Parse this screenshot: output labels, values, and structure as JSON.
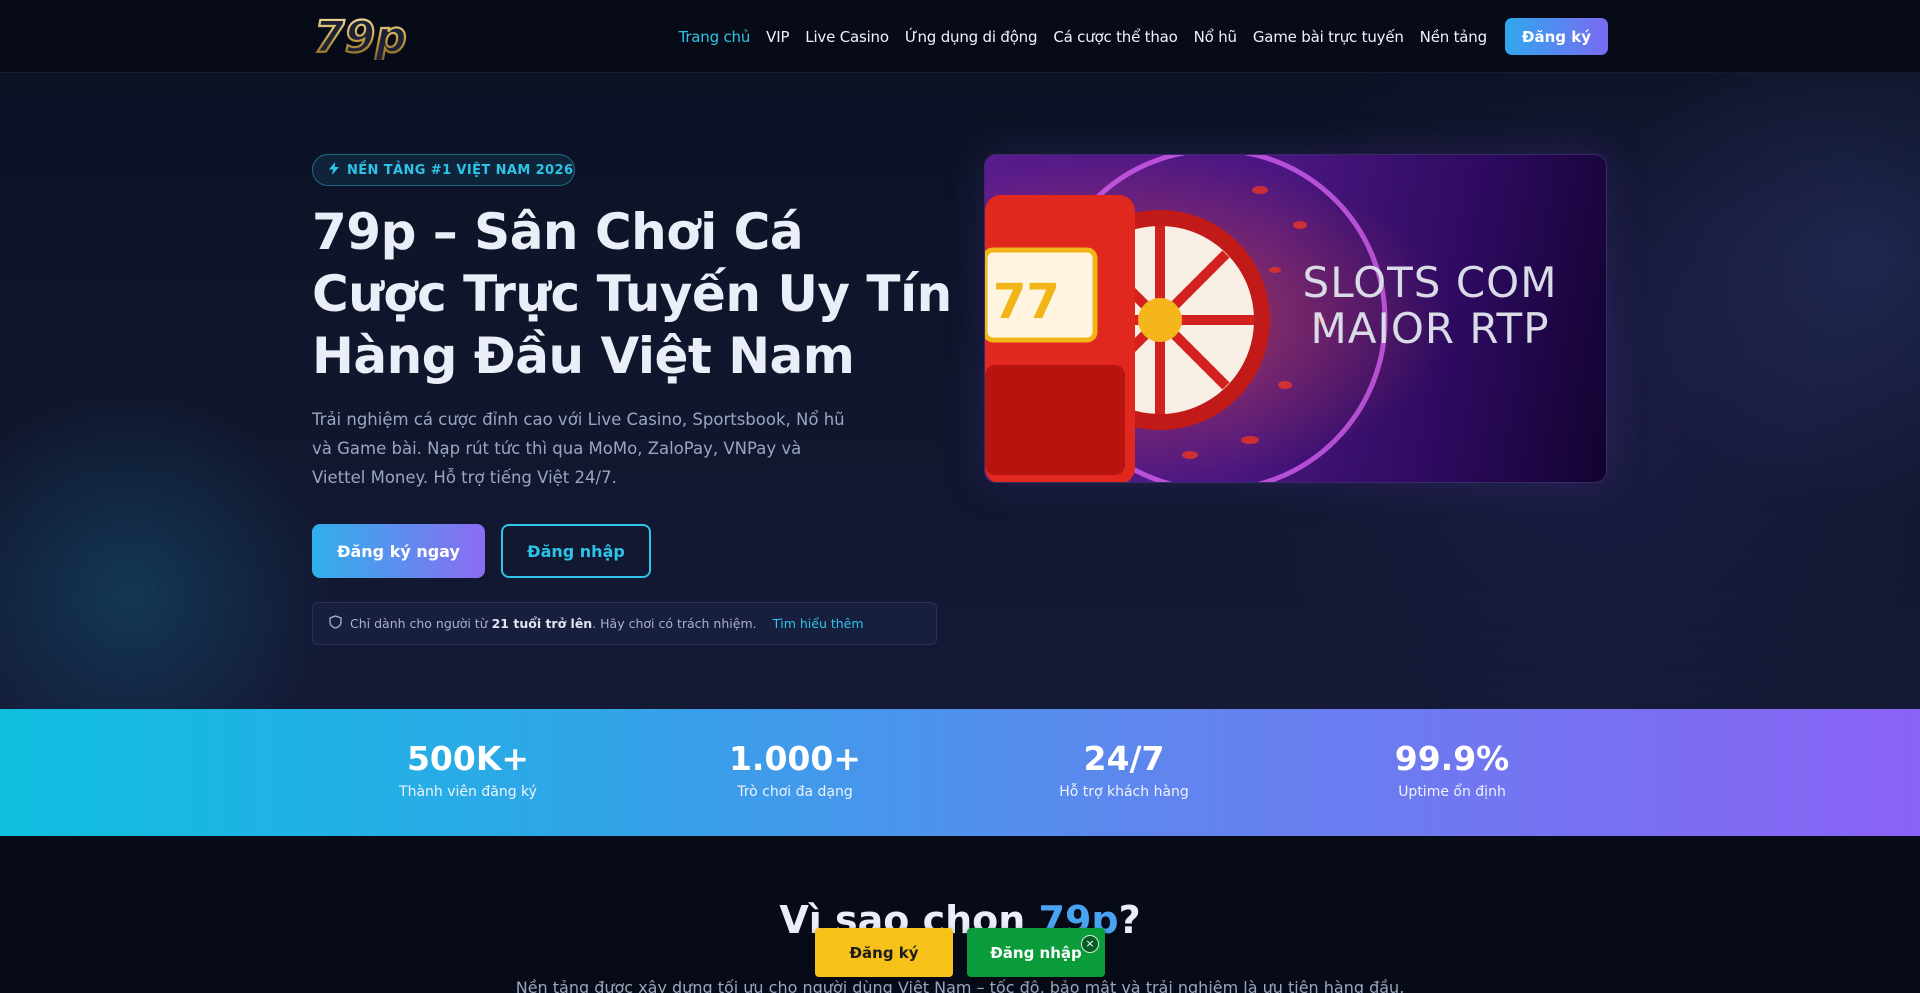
{
  "nav": {
    "logo_text": "79p",
    "links": [
      "Trang chủ",
      "VIP",
      "Live Casino",
      "Ứng dụng di động",
      "Cá cược thể thao",
      "Nổ hũ",
      "Game bài trực tuyến",
      "Nền tảng"
    ],
    "active_index": 0,
    "register_label": "Đăng ký"
  },
  "hero": {
    "badge": "NỀN TẢNG #1 VIỆT NAM 2026",
    "title": "79p – Sân Chơi Cá Cược Trực Tuyến Uy Tín Hàng Đầu Việt Nam",
    "description": "Trải nghiệm cá cược đỉnh cao với Live Casino, Sportsbook, Nổ hũ và Game bài. Nạp rút tức thì qua MoMo, ZaloPay, VNPay và Viettel Money. Hỗ trợ tiếng Việt 24/7.",
    "cta_primary": "Đăng ký ngay",
    "cta_secondary": "Đăng nhập",
    "notice_prefix": "Chỉ dành cho người từ",
    "notice_bold": "21 tuổi trở lên",
    "notice_suffix": ". Hãy chơi có trách nhiệm.",
    "notice_link": "Tìm hiểu thêm",
    "image_text": "SLOTS COM MAIOR RTP",
    "image_reel": "77"
  },
  "stats": [
    {
      "value": "500K+",
      "label": "Thành viên đăng ký"
    },
    {
      "value": "1.000+",
      "label": "Trò chơi đa dạng"
    },
    {
      "value": "24/7",
      "label": "Hỗ trợ khách hàng"
    },
    {
      "value": "99.9%",
      "label": "Uptime ổn định"
    }
  ],
  "why": {
    "title_prefix": "Vì sao chọn ",
    "title_accent": "79p",
    "title_suffix": "?",
    "subtitle": "Nền tảng được xây dựng tối ưu cho người dùng Việt Nam – tốc độ, bảo mật và trải nghiệm là ưu tiên hàng đầu."
  },
  "floating": {
    "register_label": "Đăng ký",
    "login_label": "Đăng nhập",
    "close_label": "×"
  },
  "colors": {
    "accent_cyan": "#2ec4e8",
    "accent_purple": "#8b6cf2",
    "float_register": "#f6c21a",
    "float_login": "#0a9b3a"
  }
}
